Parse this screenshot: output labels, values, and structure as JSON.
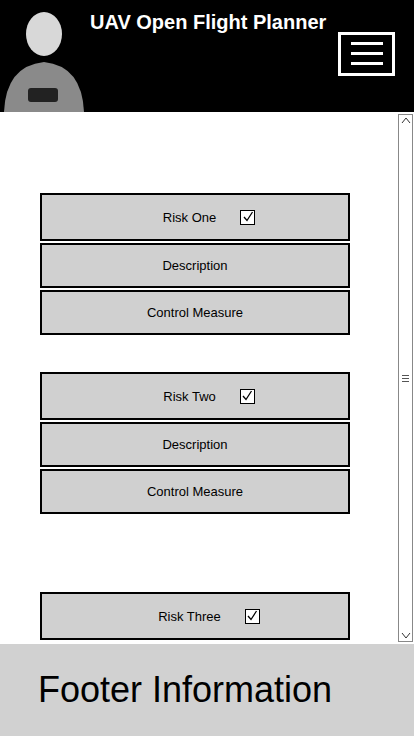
{
  "header": {
    "title": "UAV Open Flight Planner"
  },
  "risks": [
    {
      "title": "Risk One",
      "checked": true,
      "rows": [
        "Description",
        "Control Measure"
      ]
    },
    {
      "title": "Risk Two",
      "checked": true,
      "rows": [
        "Description",
        "Control Measure"
      ]
    },
    {
      "title": "Risk Three",
      "checked": true,
      "rows": []
    }
  ],
  "footer": {
    "text": "Footer Information"
  }
}
